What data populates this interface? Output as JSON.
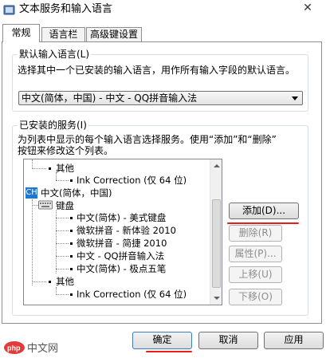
{
  "window": {
    "title": "文本服务和输入语言",
    "close_glyph": "✕"
  },
  "tabs": [
    {
      "label": "常规",
      "active": true
    },
    {
      "label": "语言栏",
      "active": false
    },
    {
      "label": "高级键设置",
      "active": false
    }
  ],
  "default_language": {
    "legend": "默认输入语言(L)",
    "description": "选择其中一个已安装的输入语言，用作所有输入字段的默认语言。",
    "selected": "中文(简体，中国) - 中文 - QQ拼音输入法"
  },
  "installed_services": {
    "legend": "已安装的服务(I)",
    "description_line1": "为列表中显示的每个输入语言选择服务。使用“添加”和“删除”",
    "description_line2": "按钮来修改这个列表。",
    "tree": {
      "other_top": "其他",
      "ink_top": "Ink Correction (仅 64 位)",
      "lang_badge": "CH",
      "lang_label": "中文(简体，中国)",
      "keyboard_label": "键盘",
      "keyboards": [
        "中文(简体) - 美式键盘",
        "微软拼音 - 新体验 2010",
        "微软拼音 - 简捷 2010",
        "中文 - QQ拼音输入法",
        "中文(简体) - 极点五笔"
      ],
      "other_bottom": "其他",
      "ink_bottom": "Ink Correction (仅 64 位)"
    },
    "buttons": {
      "add": "添加(D)...",
      "remove": "删除(R)",
      "properties": "属性(P)...",
      "move_up": "上移(U)",
      "move_down": "下移(O)"
    }
  },
  "footer": {
    "ok": "确定",
    "cancel": "取消",
    "apply": "应用"
  },
  "watermark": {
    "text": "php 中文网"
  },
  "colors": {
    "accent_red": "#e81c1c",
    "lang_badge_bg": "#1e78d2"
  },
  "icons": {
    "title": "globe-keyboard-icon",
    "keyboard": "keyboard-icon",
    "close": "close-icon",
    "combo": "dropdown-arrow-icon"
  }
}
